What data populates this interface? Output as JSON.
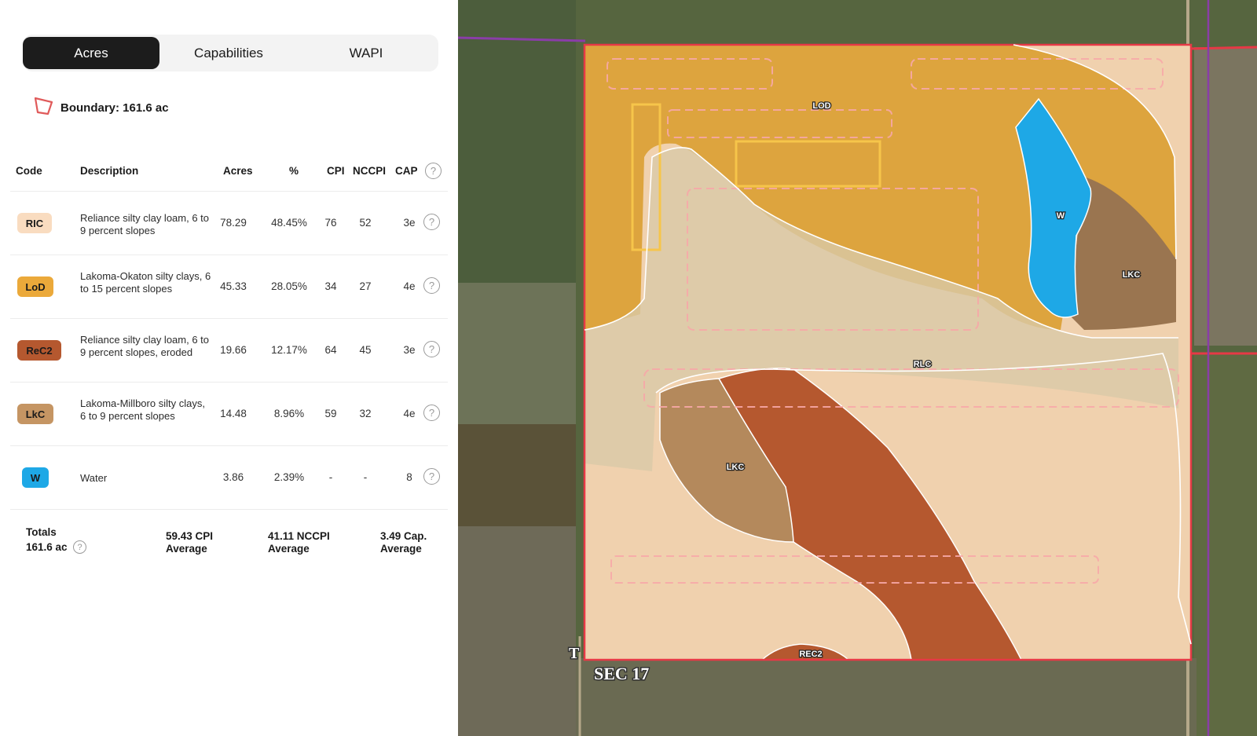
{
  "tabs": [
    {
      "label": "Acres",
      "active": true
    },
    {
      "label": "Capabilities",
      "active": false
    },
    {
      "label": "WAPI",
      "active": false
    }
  ],
  "boundary": {
    "label": "Boundary: 161.6 ac",
    "icon": "polygon-boundary-icon",
    "color": "#e05a5a"
  },
  "table": {
    "headers": {
      "code": "Code",
      "description": "Description",
      "acres": "Acres",
      "percent": "%",
      "cpi": "CPI",
      "nccpi": "NCCPI",
      "cap": "CAP"
    },
    "help_glyph": "?",
    "rows": [
      {
        "code": "RIC",
        "badge_bg": "#f9dcc0",
        "badge_fg": "#1a1a1a",
        "description": "Reliance silty clay loam, 6 to 9 percent slopes",
        "acres": "78.29",
        "percent": "48.45%",
        "cpi": "76",
        "nccpi": "52",
        "cap": "3e"
      },
      {
        "code": "LoD",
        "badge_bg": "#eba93a",
        "badge_fg": "#1a1a1a",
        "description": "Lakoma-Okaton silty clays, 6 to 15 percent slopes",
        "acres": "45.33",
        "percent": "28.05%",
        "cpi": "34",
        "nccpi": "27",
        "cap": "4e"
      },
      {
        "code": "ReC2",
        "badge_bg": "#b5582f",
        "badge_fg": "#1a1a1a",
        "description": "Reliance silty clay loam, 6 to 9 percent slopes, eroded",
        "acres": "19.66",
        "percent": "12.17%",
        "cpi": "64",
        "nccpi": "45",
        "cap": "3e"
      },
      {
        "code": "LkC",
        "badge_bg": "#c59563",
        "badge_fg": "#1a1a1a",
        "description": "Lakoma-Millboro silty clays, 6 to 9 percent slopes",
        "acres": "14.48",
        "percent": "8.96%",
        "cpi": "59",
        "nccpi": "32",
        "cap": "4e"
      },
      {
        "code": "W",
        "badge_bg": "#1ea8e6",
        "badge_fg": "#1a1a1a",
        "description": "Water",
        "acres": "3.86",
        "percent": "2.39%",
        "cpi": "-",
        "nccpi": "-",
        "cap": "8"
      }
    ],
    "totals": {
      "label": "Totals",
      "acres": "161.6 ac",
      "cpi_avg": "59.43 CPI",
      "cpi_avg_sub": "Average",
      "nccpi_avg": "41.11 NCCPI",
      "nccpi_avg_sub": "Average",
      "cap_avg": "3.49 Cap.",
      "cap_avg_sub": "Average"
    }
  },
  "map": {
    "labels": {
      "lod": "LOD",
      "w": "W",
      "lkc_east": "LKC",
      "rlc": "RLC",
      "lkc_west": "LKC",
      "rec2": "REC2"
    },
    "section_label": "SEC 17",
    "township_label": "T",
    "colors": {
      "boundary": "#e63946",
      "ric": "#f9dcc0",
      "lod": "#eba93a",
      "rec2": "#b5582f",
      "lkc": "#c59563",
      "water": "#1ea8e6"
    }
  }
}
